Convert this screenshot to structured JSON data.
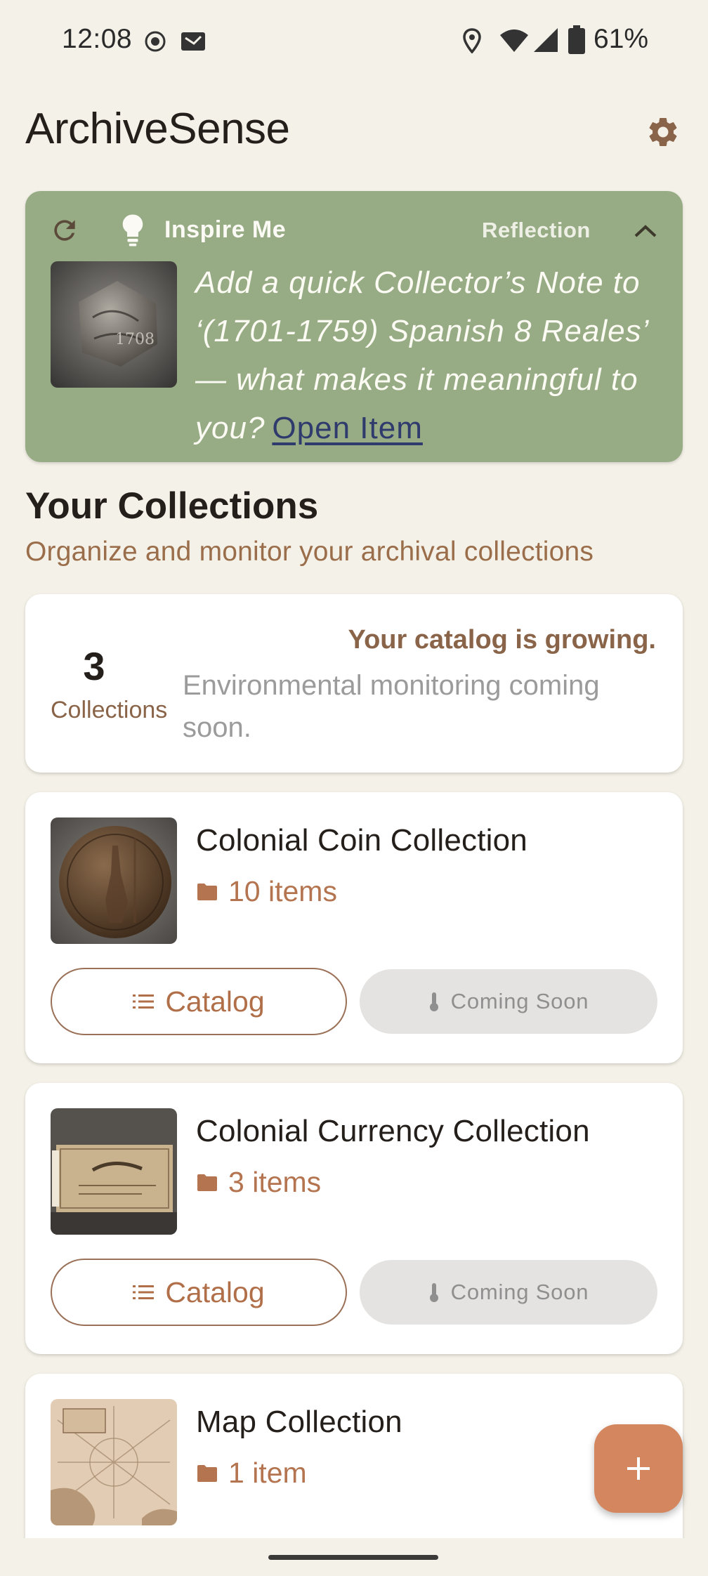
{
  "status_bar": {
    "time": "12:08",
    "battery": "61%",
    "icons": [
      "record-icon",
      "cast-icon",
      "location-icon",
      "wifi-icon",
      "signal-icon",
      "battery-icon"
    ]
  },
  "app_bar": {
    "title": "ArchiveSense",
    "settings_icon": "gear-icon"
  },
  "inspire": {
    "title": "Inspire Me",
    "tag": "Reflection",
    "prompt": "Add a quick Collector’s Note to ‘(1701-1759) Spanish 8 Reales’ — what makes it meaningful to you?",
    "link": "Open Item",
    "background": "#97ab85"
  },
  "section": {
    "title": "Your Collections",
    "subtitle": "Organize and monitor your archival collections"
  },
  "summary": {
    "count": "3",
    "count_label": "Collections",
    "headline": "Your catalog is growing.",
    "note": "Environmental monitoring coming soon."
  },
  "collections": [
    {
      "name": "Colonial Coin Collection",
      "count": "10 items",
      "catalog_label": "Catalog",
      "monitor_label": "Coming Soon"
    },
    {
      "name": "Colonial Currency Collection",
      "count": "3 items",
      "catalog_label": "Catalog",
      "monitor_label": "Coming Soon"
    },
    {
      "name": "Map Collection",
      "count": "1 item"
    }
  ],
  "fab": {
    "icon": "plus-icon"
  },
  "colors": {
    "accent": "#b06f48",
    "background": "#f4f1e8",
    "fab": "#d4875f"
  }
}
